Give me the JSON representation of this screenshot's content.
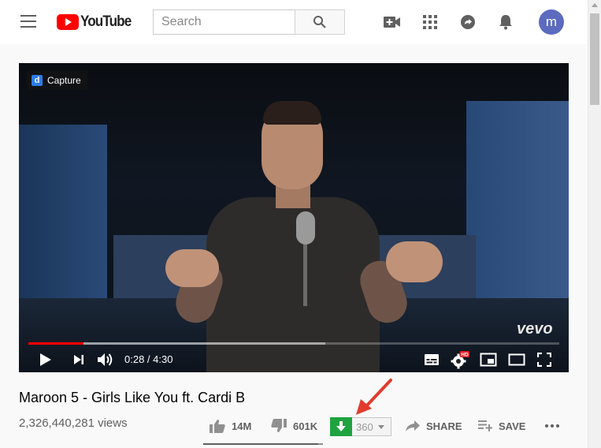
{
  "header": {
    "logo_text": "YouTube",
    "search_placeholder": "Search",
    "avatar_letter": "m"
  },
  "icons": {
    "menu": "hamburger-icon",
    "search": "search-icon",
    "create": "video-camera-plus-icon",
    "apps": "apps-grid-icon",
    "messages": "share-arrow-icon",
    "notifications": "bell-icon"
  },
  "colors": {
    "brand_red": "#ff0000",
    "download_green": "#1fa33f",
    "avatar": "#5c6bc0",
    "annotation_arrow": "#e23b2e"
  },
  "player": {
    "overlay_badge": "Capture",
    "overlay_badge_logo": "d",
    "watermark": "vevo",
    "time_current": "0:28",
    "time_total": "4:30",
    "time_display": "0:28 / 4:30",
    "played_fraction": 0.104,
    "buffered_fraction": 0.56,
    "hd_badge": "HD"
  },
  "video": {
    "title": "Maroon 5 - Girls Like You ft. Cardi B",
    "views": "2,326,440,281 views"
  },
  "actions": {
    "likes": "14M",
    "dislikes": "601K",
    "like_ratio": 0.959,
    "download_quality": "360",
    "share_label": "SHARE",
    "save_label": "SAVE"
  }
}
